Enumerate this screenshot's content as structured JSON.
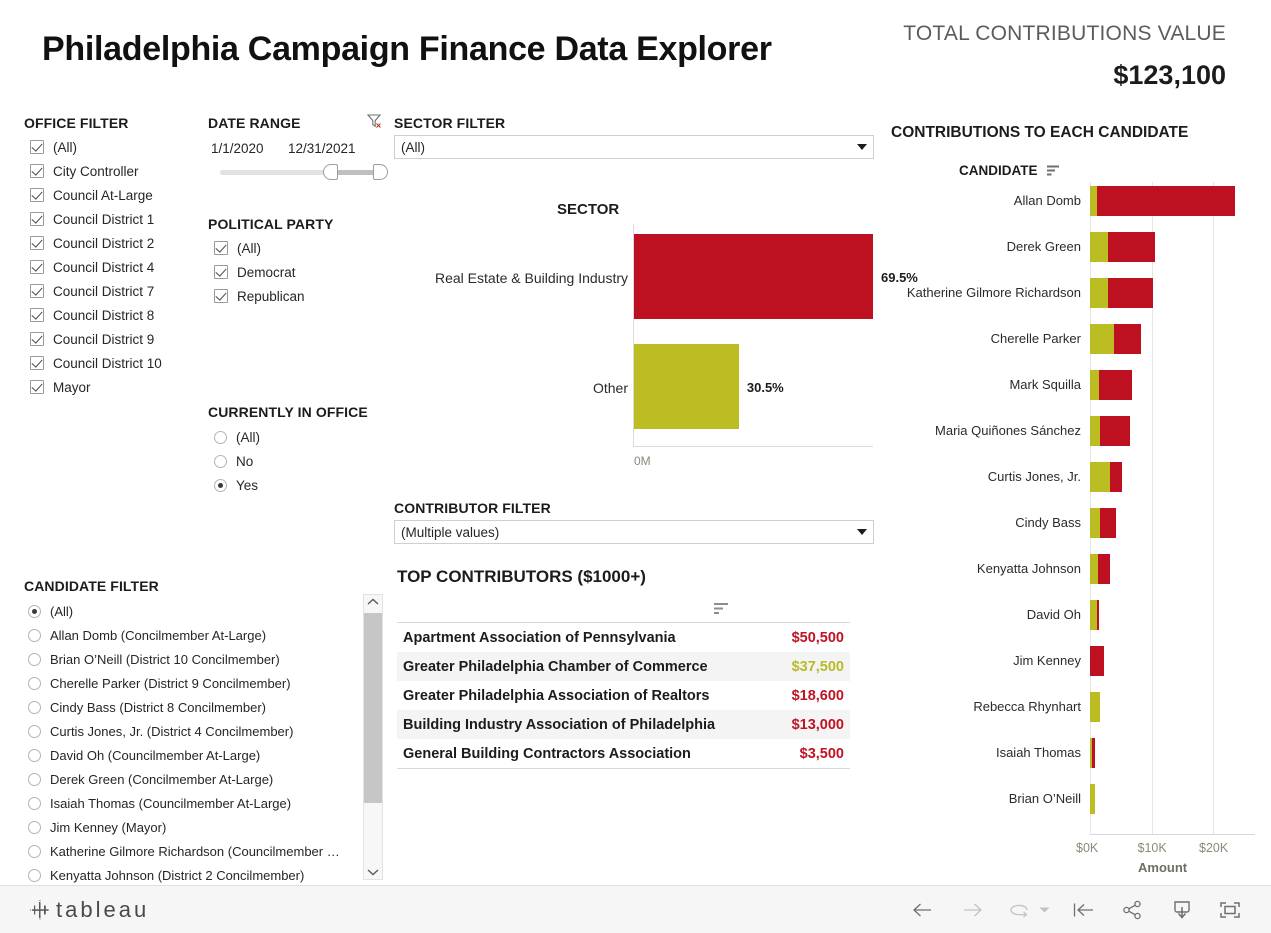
{
  "header": {
    "title": "Philadelphia Campaign Finance Data Explorer",
    "kpi_label": "TOTAL CONTRIBUTIONS VALUE",
    "kpi_value": "$123,100"
  },
  "colors": {
    "red": "#BD1021",
    "olive": "#BCBD22",
    "red_text": "#C01324",
    "olive_text": "#B9BA27"
  },
  "office_filter": {
    "heading": "OFFICE FILTER",
    "items": [
      {
        "label": "(All)",
        "checked": true
      },
      {
        "label": "City Controller",
        "checked": true
      },
      {
        "label": "Council At-Large",
        "checked": true
      },
      {
        "label": "Council District 1",
        "checked": true
      },
      {
        "label": "Council District 2",
        "checked": true
      },
      {
        "label": "Council District 4",
        "checked": true
      },
      {
        "label": "Council District 7",
        "checked": true
      },
      {
        "label": "Council District 8",
        "checked": true
      },
      {
        "label": "Council District 9",
        "checked": true
      },
      {
        "label": "Council District 10",
        "checked": true
      },
      {
        "label": "Mayor",
        "checked": true
      }
    ]
  },
  "date_range": {
    "heading": "DATE RANGE",
    "start": "1/1/2020",
    "end": "12/31/2021",
    "clear_icon": "clear-filter-icon"
  },
  "political_party": {
    "heading": "POLITICAL PARTY",
    "items": [
      {
        "label": "(All)",
        "checked": true
      },
      {
        "label": "Democrat",
        "checked": true
      },
      {
        "label": "Republican",
        "checked": true
      }
    ]
  },
  "currently_in_office": {
    "heading": "CURRENTLY IN OFFICE",
    "items": [
      {
        "label": "(All)",
        "selected": false
      },
      {
        "label": "No",
        "selected": false
      },
      {
        "label": "Yes",
        "selected": true
      }
    ]
  },
  "sector_filter": {
    "heading": "SECTOR FILTER",
    "value": "(All)"
  },
  "contributor_filter": {
    "heading": "CONTRIBUTOR FILTER",
    "value": "(Multiple values)"
  },
  "candidate_filter": {
    "heading": "CANDIDATE FILTER",
    "items": [
      {
        "label": "(All)",
        "selected": true
      },
      {
        "label": "Allan Domb (Concilmember At-Large)",
        "selected": false
      },
      {
        "label": "Brian O’Neill (District 10 Concilmember)",
        "selected": false
      },
      {
        "label": "Cherelle Parker (District 9 Concilmember)",
        "selected": false
      },
      {
        "label": "Cindy Bass (District 8 Concilmember)",
        "selected": false
      },
      {
        "label": "Curtis Jones, Jr. (District 4 Concilmember)",
        "selected": false
      },
      {
        "label": "David Oh (Councilmember At-Large)",
        "selected": false
      },
      {
        "label": "Derek Green (Concilmember At-Large)",
        "selected": false
      },
      {
        "label": "Isaiah Thomas (Councilmember At-Large)",
        "selected": false
      },
      {
        "label": "Jim Kenney (Mayor)",
        "selected": false
      },
      {
        "label": "Katherine Gilmore Richardson (Councilmember …",
        "selected": false
      },
      {
        "label": "Kenyatta Johnson (District 2 Concilmember)",
        "selected": false
      }
    ]
  },
  "top_contributors": {
    "title": "TOP CONTRIBUTORS ($1000+)",
    "sort_icon": "sort-descending-icon",
    "rows": [
      {
        "name": "Apartment Association of Pennsylvania",
        "amount": "$50,500",
        "color": "#C01324"
      },
      {
        "name": "Greater Philadelphia Chamber of Commerce",
        "amount": "$37,500",
        "color": "#B9BA27"
      },
      {
        "name": "Greater Philadelphia Association of Realtors",
        "amount": "$18,600",
        "color": "#C01324"
      },
      {
        "name": "Building Industry Association of Philadelphia",
        "amount": "$13,000",
        "color": "#C01324"
      },
      {
        "name": "General Building Contractors Association",
        "amount": "$3,500",
        "color": "#C01324"
      }
    ]
  },
  "candidate_chart": {
    "title": "CONTRIBUTIONS TO EACH CANDIDATE",
    "column_header": "CANDIDATE",
    "sort_icon": "sort-descending-icon"
  },
  "footer": {
    "logo": "tableau",
    "buttons": [
      {
        "name": "back-button",
        "icon": "arrow-left-icon"
      },
      {
        "name": "forward-button",
        "icon": "arrow-right-icon"
      },
      {
        "name": "refresh-button",
        "icon": "refresh-icon"
      },
      {
        "name": "refresh-dropdown-button",
        "icon": "chevron-down-icon"
      },
      {
        "name": "revert-button",
        "icon": "revert-icon"
      },
      {
        "name": "share-button",
        "icon": "share-icon"
      },
      {
        "name": "download-button",
        "icon": "download-icon"
      },
      {
        "name": "fullscreen-button",
        "icon": "fullscreen-icon"
      }
    ]
  },
  "chart_data": [
    {
      "type": "bar",
      "title": "SECTOR",
      "orientation": "horizontal",
      "xlabel": "",
      "ylabel": "",
      "categories": [
        "Real Estate & Building Industry",
        "Other"
      ],
      "values": [
        69.5,
        30.5
      ],
      "labels": [
        "69.5%",
        "30.5%"
      ],
      "colors": [
        "#BD1021",
        "#BCBD22"
      ],
      "axis_ticks": [
        "0M"
      ],
      "grid": false,
      "legend": "none"
    },
    {
      "type": "bar",
      "subtype": "stacked",
      "title": "CONTRIBUTIONS TO EACH CANDIDATE",
      "orientation": "horizontal",
      "xlabel": "Amount",
      "ylabel": "CANDIDATE",
      "xlim": [
        0,
        24000
      ],
      "axis_ticks": [
        "$0K",
        "$10K",
        "$20K"
      ],
      "axis_tick_values": [
        0,
        10000,
        20000
      ],
      "grid": true,
      "legend": "none",
      "categories": [
        "Allan Domb",
        "Derek Green",
        "Katherine Gilmore Richardson",
        "Cherelle Parker",
        "Mark Squilla",
        "Maria Quiñones Sánchez",
        "Curtis Jones, Jr.",
        "Cindy Bass",
        "Kenyatta Johnson",
        "David Oh",
        "Jim Kenney",
        "Rebecca Rhynhart",
        "Isaiah Thomas",
        "Brian O’Neill"
      ],
      "series": [
        {
          "name": "Other",
          "color": "#BCBD22",
          "values": [
            1100,
            3000,
            3000,
            3900,
            1400,
            1600,
            3300,
            1700,
            1300,
            1100,
            0,
            1700,
            300,
            800
          ]
        },
        {
          "name": "Real Estate & Building Industry",
          "color": "#BD1021",
          "values": [
            22400,
            7600,
            7200,
            4400,
            5400,
            4900,
            1900,
            2600,
            1900,
            300,
            2300,
            0,
            500,
            0
          ]
        }
      ]
    }
  ]
}
